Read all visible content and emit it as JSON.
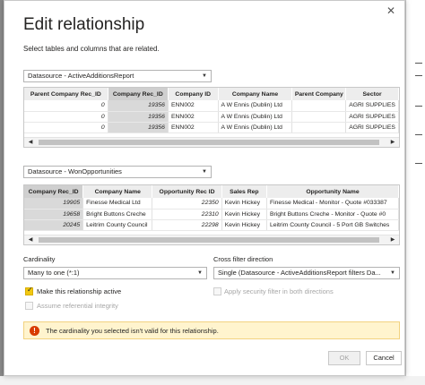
{
  "dialog": {
    "title": "Edit relationship",
    "close_glyph": "✕",
    "subtitle": "Select tables and columns that are related."
  },
  "table1": {
    "selector": "Datasource - ActiveAdditionsReport",
    "columns": [
      "Parent Company Rec_ID",
      "Company Rec_ID",
      "Company ID",
      "Company Name",
      "Parent Company",
      "Sector"
    ],
    "rows": [
      [
        "0",
        "19356",
        "ENN002",
        "A W Ennis (Dublin) Ltd",
        "",
        "AGRI SUPPLIES"
      ],
      [
        "0",
        "19356",
        "ENN002",
        "A W Ennis (Dublin) Ltd",
        "",
        "AGRI SUPPLIES"
      ],
      [
        "0",
        "19356",
        "ENN002",
        "A W Ennis (Dublin) Ltd",
        "",
        "AGRI SUPPLIES"
      ]
    ],
    "selected_column": 1
  },
  "table2": {
    "selector": "Datasource - WonOpportunities",
    "columns": [
      "Company Rec_ID",
      "Company Name",
      "Opportunity Rec ID",
      "Sales Rep",
      "Opportunity Name"
    ],
    "rows": [
      [
        "19905",
        "Finesse Medical Ltd",
        "22350",
        "Kevin Hickey",
        "Finesse Medical - Monitor - Quote #033387"
      ],
      [
        "19658",
        "Bright Buttons Creche",
        "22310",
        "Kevin Hickey",
        "Bright Buttons Creche - Monitor - Quote #0"
      ],
      [
        "20245",
        "Leitrim County Council",
        "22298",
        "Kevin Hickey",
        "Leitrim County Council - 5 Port GB Switches"
      ]
    ],
    "selected_column": 0
  },
  "cardinality": {
    "label": "Cardinality",
    "value": "Many to one (*:1)"
  },
  "cross_filter": {
    "label": "Cross filter direction",
    "value": "Single (Datasource - ActiveAdditionsReport filters Da..."
  },
  "options": {
    "make_active": "Make this relationship active",
    "assume_integrity": "Assume referential integrity",
    "security_filter": "Apply security filter in both directions"
  },
  "warning": {
    "icon": "!",
    "text": "The cardinality you selected isn't valid for this relationship."
  },
  "buttons": {
    "ok": "OK",
    "cancel": "Cancel"
  },
  "colors": {
    "accent": "#f2c811",
    "warning_bg": "#fff4ce",
    "error_icon": "#d83b01"
  }
}
